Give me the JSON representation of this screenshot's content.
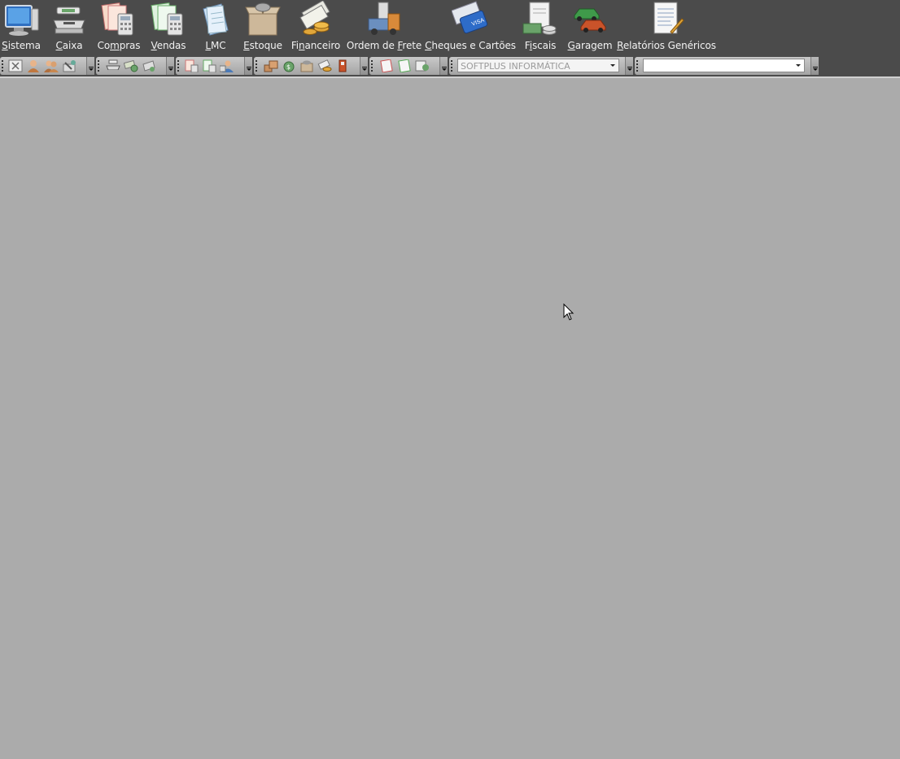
{
  "menu": [
    {
      "label": "Sistema",
      "accel": "S",
      "rest": "istema",
      "icon": "computer-monitor-icon"
    },
    {
      "label": "Caixa",
      "accel": "C",
      "rest": "aixa",
      "icon": "cash-register-icon"
    },
    {
      "label": "Compras",
      "pre": "Co",
      "accel": "m",
      "rest": "pras",
      "icon": "purchase-calculator-icon"
    },
    {
      "label": "Vendas",
      "accel": "V",
      "rest": "endas",
      "icon": "sales-documents-icon"
    },
    {
      "label": "LMC",
      "accel": "L",
      "rest": "MC",
      "icon": "lmc-document-icon"
    },
    {
      "label": "Estoque",
      "accel": "E",
      "rest": "stoque",
      "icon": "stock-box-icon"
    },
    {
      "label": "Financeiro",
      "pre": "Fi",
      "accel": "n",
      "rest": "anceiro",
      "icon": "money-coins-icon"
    },
    {
      "label": "Ordem de Frete",
      "pre": "Ordem de ",
      "accel": "F",
      "rest": "rete",
      "icon": "freight-truck-icon"
    },
    {
      "label": "Cheques e Cartões",
      "accel": "C",
      "rest": "heques e Cartões",
      "icon": "cheques-cards-icon"
    },
    {
      "label": "Fiscais",
      "pre": "F",
      "accel": "i",
      "rest": "scais",
      "icon": "fiscal-money-icon"
    },
    {
      "label": "Garagem",
      "accel": "G",
      "rest": "aragem",
      "icon": "garage-cars-icon"
    },
    {
      "label": "Relatórios Genéricos",
      "accel": "R",
      "rest": "elatórios Genéricos",
      "icon": "reports-document-icon"
    }
  ],
  "toolbar": {
    "company_combo": "SOFTPLUS INFORMÁTICA",
    "second_combo": ""
  },
  "colors": {
    "menubar_bg": "#4b4b4b",
    "workspace_bg": "#ababab"
  }
}
